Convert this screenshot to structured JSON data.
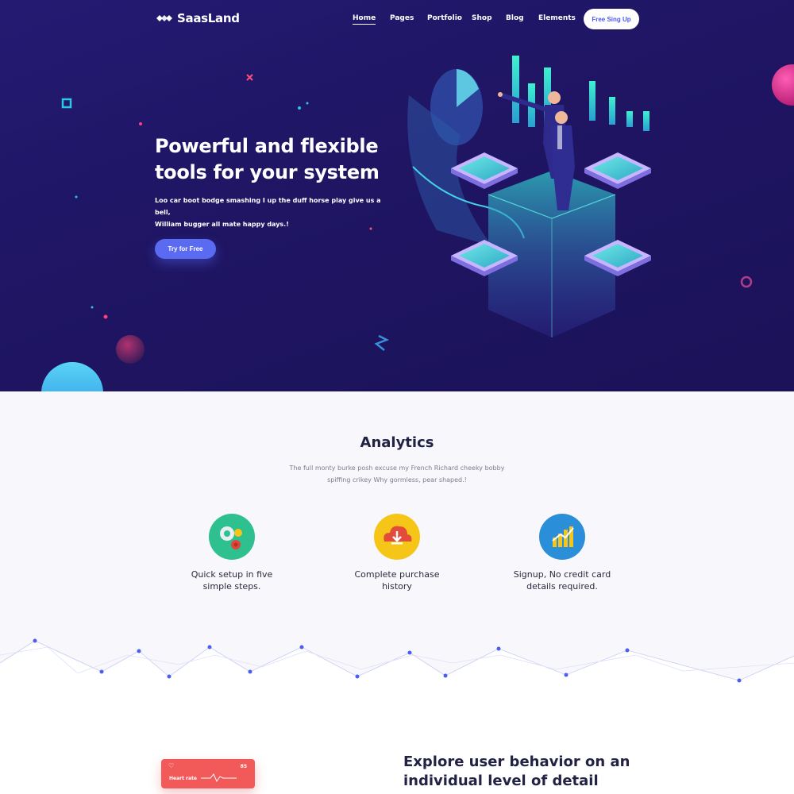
{
  "nav": {
    "logo_text": "SaasLand",
    "items": [
      {
        "label": "Home",
        "active": true
      },
      {
        "label": "Pages",
        "active": false
      },
      {
        "label": "Portfolio",
        "active": false
      },
      {
        "label": "Shop",
        "active": false
      },
      {
        "label": "Blog",
        "active": false
      },
      {
        "label": "Elements",
        "active": false
      }
    ],
    "signup_label": "Free Sing Up"
  },
  "hero": {
    "title_line1": "Powerful and flexible",
    "title_line2": "tools for your system",
    "desc_line1": "Loo car boot bodge smashing I up the duff horse play give us a bell,",
    "desc_line2": "William bugger all mate happy days.!",
    "cta_label": "Try for Free",
    "illustration": "isometric-analytics-illustration"
  },
  "analytics": {
    "title": "Analytics",
    "desc_line1": "The full monty burke posh excuse my French Richard cheeky bobby",
    "desc_line2": "spiffing crikey Why gormless, pear shaped.!",
    "features": [
      {
        "icon": "gears-icon",
        "line1": "Quick setup in five",
        "line2": "simple steps.",
        "color": "#2ec08e"
      },
      {
        "icon": "cloud-download-icon",
        "line1": "Complete purchase",
        "line2": "history",
        "color": "#f5c518"
      },
      {
        "icon": "growth-chart-icon",
        "line1": "Signup, No credit card",
        "line2": "details required.",
        "color": "#2a8fd8"
      }
    ]
  },
  "lower": {
    "card_label": "Heart rate",
    "card_value": "85",
    "explore_line1": "Explore user behavior on an",
    "explore_line2": "individual level of detail"
  },
  "colors": {
    "hero_bg": "#221868",
    "accent": "#5a6bf2",
    "heart_card": "#f25a5a"
  }
}
